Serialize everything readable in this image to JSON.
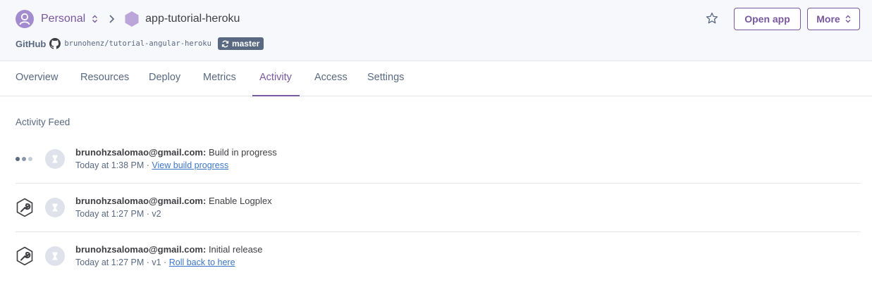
{
  "header": {
    "team": "Personal",
    "app_name": "app-tutorial-heroku",
    "github_label": "GitHub",
    "repo": "brunohenz/tutorial-angular-heroku",
    "branch": "master",
    "open_app_label": "Open app",
    "more_label": "More"
  },
  "tabs": [
    {
      "label": "Overview",
      "active": false
    },
    {
      "label": "Resources",
      "active": false
    },
    {
      "label": "Deploy",
      "active": false
    },
    {
      "label": "Metrics",
      "active": false
    },
    {
      "label": "Activity",
      "active": true
    },
    {
      "label": "Access",
      "active": false
    },
    {
      "label": "Settings",
      "active": false
    }
  ],
  "feed": {
    "title": "Activity Feed",
    "items": [
      {
        "status_icon": "in-progress-dots-icon",
        "user": "brunohzsalomao@gmail.com:",
        "action": "Build in progress",
        "meta": "Today at 1:38 PM ·",
        "link": "View build progress"
      },
      {
        "status_icon": "wrench-icon",
        "user": "brunohzsalomao@gmail.com:",
        "action": "Enable Logplex",
        "meta": "Today at 1:27 PM · v2",
        "link": ""
      },
      {
        "status_icon": "wrench-icon",
        "user": "brunohzsalomao@gmail.com:",
        "action": "Initial release",
        "meta": "Today at 1:27 PM · v1 ·",
        "link": "Roll back to here"
      }
    ]
  },
  "colors": {
    "accent": "#79589f",
    "header_bg": "#f7f8fb",
    "muted": "#596981",
    "link": "#3d76c8"
  }
}
